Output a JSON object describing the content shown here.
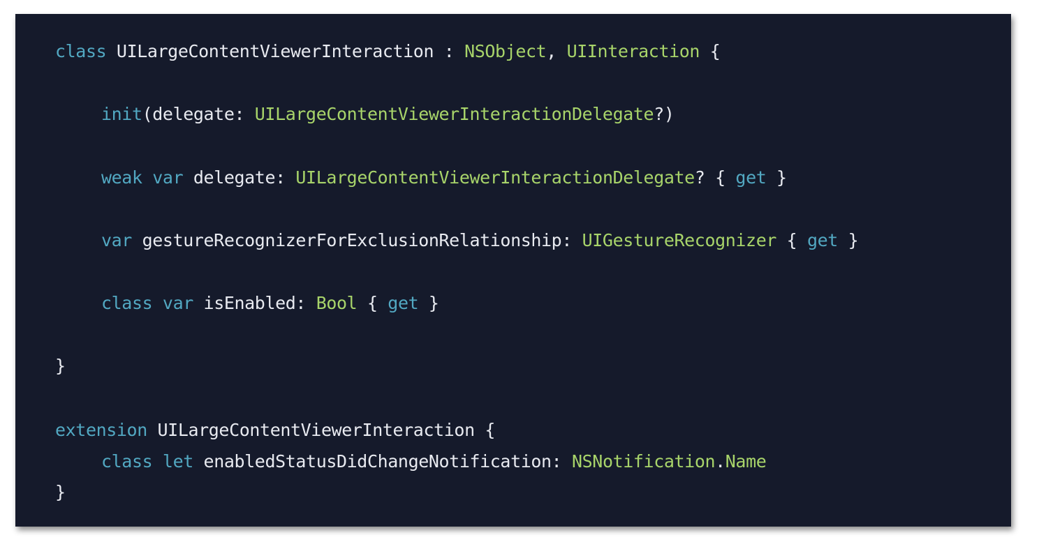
{
  "colors": {
    "background": "#151a2b",
    "keyword": "#52a8c2",
    "type": "#a8d46a",
    "plain": "#e8eaf0"
  },
  "lines": [
    {
      "indent": false,
      "tokens": [
        {
          "text": "class",
          "kind": "keyword"
        },
        {
          "text": " UILargeContentViewerInteraction : ",
          "kind": "plain"
        },
        {
          "text": "NSObject",
          "kind": "type"
        },
        {
          "text": ", ",
          "kind": "plain"
        },
        {
          "text": "UIInteraction",
          "kind": "type"
        },
        {
          "text": " {",
          "kind": "plain"
        }
      ]
    },
    {
      "indent": true,
      "tokens": [
        {
          "text": "init",
          "kind": "keyword"
        },
        {
          "text": "(delegate: ",
          "kind": "plain"
        },
        {
          "text": "UILargeContentViewerInteractionDelegate",
          "kind": "type"
        },
        {
          "text": "?)",
          "kind": "plain"
        }
      ]
    },
    {
      "indent": true,
      "tokens": [
        {
          "text": "weak",
          "kind": "keyword"
        },
        {
          "text": " ",
          "kind": "plain"
        },
        {
          "text": "var",
          "kind": "keyword"
        },
        {
          "text": " delegate: ",
          "kind": "plain"
        },
        {
          "text": "UILargeContentViewerInteractionDelegate",
          "kind": "type"
        },
        {
          "text": "? { ",
          "kind": "plain"
        },
        {
          "text": "get",
          "kind": "keyword"
        },
        {
          "text": " }",
          "kind": "plain"
        }
      ]
    },
    {
      "indent": true,
      "tokens": [
        {
          "text": "var",
          "kind": "keyword"
        },
        {
          "text": " gestureRecognizerForExclusionRelationship: ",
          "kind": "plain"
        },
        {
          "text": "UIGestureRecognizer",
          "kind": "type"
        },
        {
          "text": " { ",
          "kind": "plain"
        },
        {
          "text": "get",
          "kind": "keyword"
        },
        {
          "text": " }",
          "kind": "plain"
        }
      ]
    },
    {
      "indent": true,
      "tokens": [
        {
          "text": "class",
          "kind": "keyword"
        },
        {
          "text": " ",
          "kind": "plain"
        },
        {
          "text": "var",
          "kind": "keyword"
        },
        {
          "text": " isEnabled: ",
          "kind": "plain"
        },
        {
          "text": "Bool",
          "kind": "type"
        },
        {
          "text": " { ",
          "kind": "plain"
        },
        {
          "text": "get",
          "kind": "keyword"
        },
        {
          "text": " }",
          "kind": "plain"
        }
      ]
    },
    {
      "indent": false,
      "tokens": [
        {
          "text": "}",
          "kind": "plain"
        }
      ]
    },
    {
      "indent": false,
      "tokens": [
        {
          "text": "extension",
          "kind": "keyword"
        },
        {
          "text": " UILargeContentViewerInteraction {",
          "kind": "plain"
        }
      ]
    },
    {
      "indent": true,
      "tokens": [
        {
          "text": "class",
          "kind": "keyword"
        },
        {
          "text": " ",
          "kind": "plain"
        },
        {
          "text": "let",
          "kind": "keyword"
        },
        {
          "text": " enabledStatusDidChangeNotification: ",
          "kind": "plain"
        },
        {
          "text": "NSNotification",
          "kind": "type"
        },
        {
          "text": ".",
          "kind": "plain"
        },
        {
          "text": "Name",
          "kind": "type"
        }
      ]
    },
    {
      "indent": false,
      "tokens": [
        {
          "text": "}",
          "kind": "plain"
        }
      ]
    }
  ]
}
